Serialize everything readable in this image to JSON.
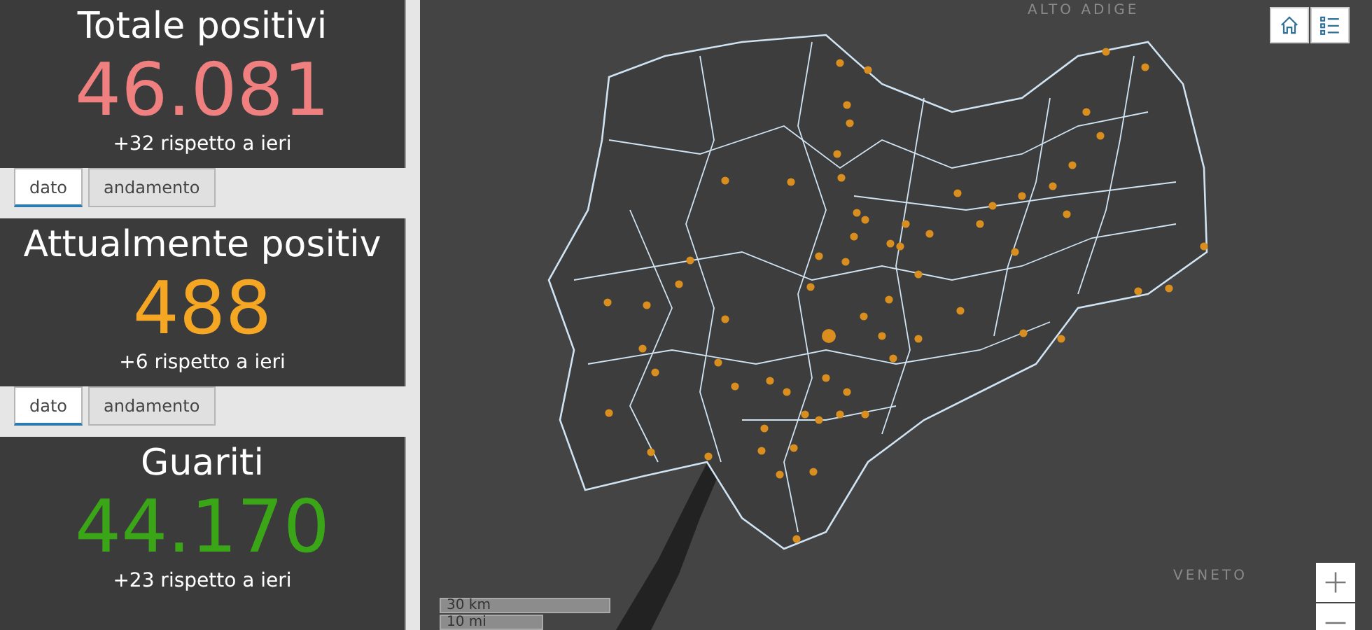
{
  "cards": [
    {
      "title": "Totale positivi",
      "value": "46.081",
      "color": "#f08080",
      "delta": "+32 rispetto a ieri",
      "tabs": [
        {
          "label": "dato",
          "selected": true
        },
        {
          "label": "andamento",
          "selected": false
        }
      ]
    },
    {
      "title": "Attualmente positiv",
      "value": "488",
      "color": "#f5a623",
      "delta": "+6 rispetto a ieri",
      "tabs": [
        {
          "label": "dato",
          "selected": true
        },
        {
          "label": "andamento",
          "selected": false
        }
      ]
    },
    {
      "title": "Guariti",
      "value": "44.170",
      "color": "#3aa517",
      "delta": "+23 rispetto a ieri"
    }
  ],
  "map": {
    "labels": [
      "ALTO ADIGE",
      "VENETO"
    ],
    "scale": [
      "30 km",
      "10 mi"
    ]
  }
}
